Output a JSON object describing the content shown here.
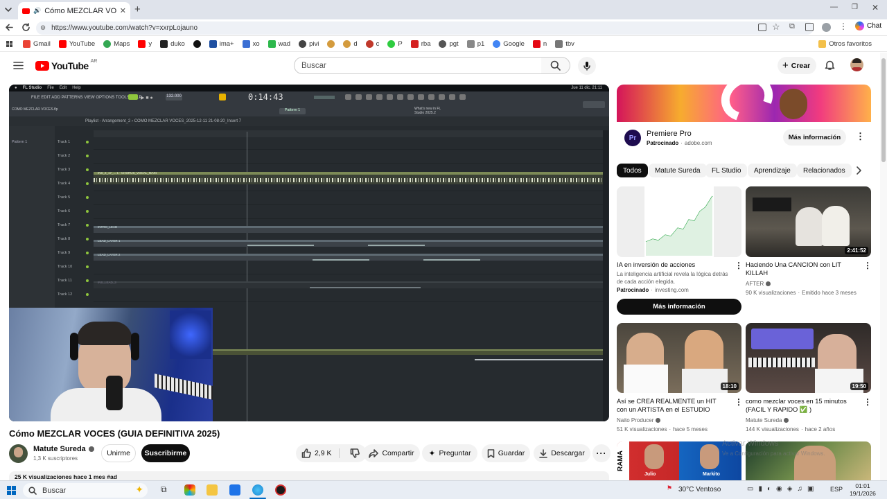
{
  "browser": {
    "tab_title": "Cómo MEZCLAR VOCES (GUÍA",
    "url": "https://www.youtube.com/watch?v=xxrpLojauno",
    "right_label": "Chat",
    "bookmarks": [
      "Gmail",
      "YouTube",
      "Maps",
      "y",
      "duko",
      "",
      "ima+",
      "xo",
      "wad",
      "pivi",
      "",
      "d",
      "c",
      "P",
      "rba",
      "pgt",
      "p1",
      "Google",
      "n",
      "tbv"
    ],
    "other_bookmarks": "Otros favoritos"
  },
  "youtube": {
    "logo_text": "YouTube",
    "logo_sup": "AR",
    "search_placeholder": "Buscar",
    "create_label": "Crear"
  },
  "player": {
    "daw": {
      "app": "FL Studio",
      "menu1": "File",
      "menu2": "Edit",
      "menu3": "Help",
      "menu_line": "FILE EDIT ADD PATTERNS VIEW OPTIONS TOOLS HELP",
      "file": "COMO MEZCLAR VOCES.flp",
      "time": "0:14:43",
      "tempo": "132.000",
      "pattern": "Pattern 1",
      "playlist_title": "Playlist - Arrangement_2 › COMO MEZCLAR VOCES_2025-12-11 21-08-20_Insert 7",
      "news_line": "What's new in FL Studio 2025.2",
      "sidebar_pattern": "Pattern 1",
      "clock": "Jue 11 dic. 21:11",
      "tracks": [
        "Track 1",
        "Track 2",
        "Track 3",
        "Track 4",
        "Track 5",
        "Track 6",
        "Track 7",
        "Track 8",
        "Track 9",
        "Track 10",
        "Track 11",
        "Track 12"
      ],
      "clip_track3": "INS_2_17_... 1 - CHORUS_VOCAL_MAIN",
      "clip_track7": "INTRO_LEAD",
      "clip_track8": "LEAD_LAYER 1",
      "clip_track9": "LEAD_LAYER 2",
      "clip_track10": "",
      "clip_track11": "INS_LEAD_3"
    }
  },
  "video": {
    "title": "Cómo MEZCLAR VOCES (GUIA DEFINITIVA 2025)",
    "channel": "Matute Sureda",
    "subscribers": "1,3 K suscriptores",
    "join_label": "Unirme",
    "subscribe_label": "Suscribirme",
    "likes": "2,9 K",
    "share_label": "Compartir",
    "ask_label": "Preguntar",
    "save_label": "Guardar",
    "download_label": "Descargar",
    "views_line": "25 K visualizaciones  hace 1 mes  #ad"
  },
  "sidebar": {
    "ad": {
      "name": "Premiere Pro",
      "sponsored": "Patrocinado",
      "domain": "adobe.com",
      "cta": "Más información"
    },
    "chips": [
      "Todos",
      "Matute Sureda",
      "FL Studio",
      "Aprendizaje",
      "Relacionados"
    ],
    "cards": [
      {
        "title": "IA en inversión de acciones",
        "desc": "La inteligencia artificial revela la lógica detrás de cada acción elegida.",
        "meta": "Patrocinado",
        "meta2": "investing.com",
        "cta": "Más información",
        "duration": ""
      },
      {
        "title": "Haciendo Una CANCION con LIT KILLAH",
        "channel": "AFTER",
        "meta": "90 K visualizaciones",
        "meta2": "Emitido hace 3 meses",
        "duration": "2:41:52"
      },
      {
        "title": "Así se CREA REALMENTE un HIT con un ARTISTA en el ESTUDIO",
        "channel": "Naito Producer",
        "meta": "51 K visualizaciones",
        "meta2": "hace 5 meses",
        "duration": "18:10"
      },
      {
        "title": "como mezclar voces en 15 minutos (FACIL Y RAPIDO ✅ )",
        "channel": "Matute Sureda",
        "meta": "144 K visualizaciones",
        "meta2": "hace 2 años",
        "duration": "19:50"
      },
      {
        "title": "",
        "channel": "",
        "meta": "",
        "meta2": "",
        "duration": "",
        "label1": "Julio",
        "label2": "Markito",
        "side_text": "RAMA"
      }
    ],
    "watermark1": "Activar Windows",
    "watermark2": "Ve a Configuración para activar Windows."
  },
  "taskbar": {
    "search": "Buscar",
    "weather": "30°C  Ventoso",
    "lang": "ESP",
    "time": "01:01",
    "date": "19/1/2026"
  },
  "colors": {
    "yt_red": "#ff0000",
    "accent_blue": "#065fd4"
  }
}
